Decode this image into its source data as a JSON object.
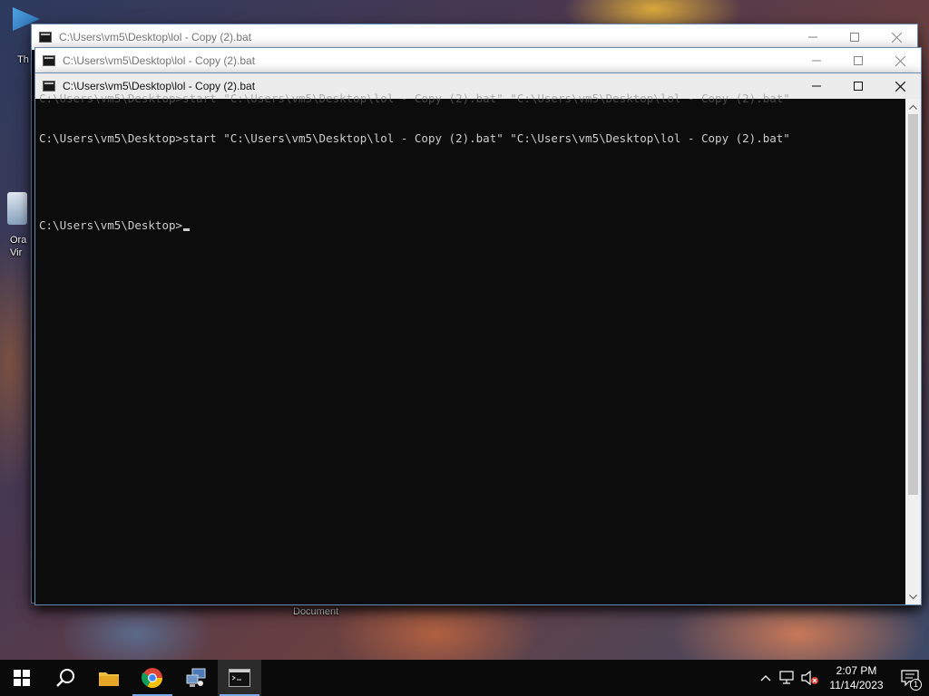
{
  "desktop": {
    "icons": [
      {
        "name": "recycle-bin",
        "label": "Th"
      },
      {
        "name": "oracle-virtualbox",
        "label_line1": "Ora",
        "label_line2": "Vir"
      }
    ],
    "doc_label": "Document"
  },
  "windows": [
    {
      "id": "back",
      "title": "C:\\Users\\vm5\\Desktop\\lol - Copy (2).bat",
      "active": false
    },
    {
      "id": "mid",
      "title": "C:\\Users\\vm5\\Desktop\\lol - Copy (2).bat",
      "active": false
    },
    {
      "id": "front",
      "title": "C:\\Users\\vm5\\Desktop\\lol - Copy (2).bat",
      "active": true,
      "ghost_text": "C:\\Users\\vm5\\Desktop>start \"C:\\Users\\vm5\\Desktop\\lol - Copy (2).bat\" \"C:\\Users\\vm5\\Desktop\\lol - Copy (2).bat\"",
      "console_lines": [
        "C:\\Users\\vm5\\Desktop>start \"C:\\Users\\vm5\\Desktop\\lol - Copy (2).bat\" \"C:\\Users\\vm5\\Desktop\\lol - Copy (2).bat\"",
        "",
        "C:\\Users\\vm5\\Desktop>"
      ]
    }
  ],
  "window_controls": {
    "minimize": "minimize",
    "maximize": "maximize",
    "close": "close"
  },
  "taskbar": {
    "items": [
      "start",
      "search",
      "file-explorer",
      "chrome",
      "network-app",
      "command-prompt"
    ],
    "active_item": "command-prompt",
    "clock": {
      "time": "2:07 PM",
      "date": "11/14/2023"
    },
    "notification_count": "1"
  },
  "colors": {
    "console_bg": "#0c0c0c",
    "console_fg": "#cccccc",
    "taskbar_bg": "#0a0a0a",
    "accent": "#7aa9e8"
  }
}
